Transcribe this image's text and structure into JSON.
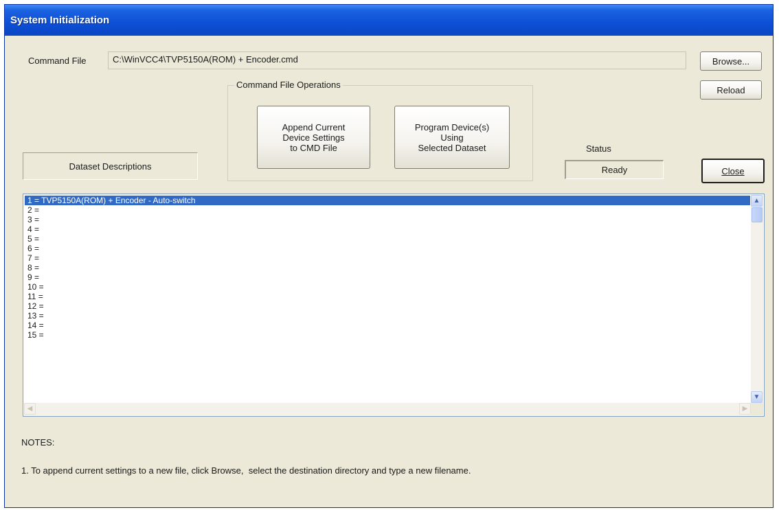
{
  "window": {
    "title": "System Initialization"
  },
  "command_file": {
    "label": "Command File",
    "value": "C:\\WinVCC4\\TVP5150A(ROM) + Encoder.cmd"
  },
  "buttons": {
    "browse": "Browse...",
    "reload": "Reload",
    "close": "Close",
    "append": "Append Current\nDevice Settings\nto CMD File",
    "program": "Program Device(s)\nUsing\nSelected Dataset"
  },
  "operations_group": {
    "title": "Command File Operations"
  },
  "dataset_descriptions": {
    "label": "Dataset Descriptions"
  },
  "status": {
    "label": "Status",
    "value": "Ready"
  },
  "dataset_list": {
    "items": [
      "1 = TVP5150A(ROM) + Encoder - Auto-switch",
      "2 =",
      "3 =",
      "4 =",
      "5 =",
      "6 =",
      "7 =",
      "8 =",
      "9 =",
      "10 =",
      "11 =",
      "12 =",
      "13 =",
      "14 =",
      "15 ="
    ],
    "selected_index": 0
  },
  "notes": {
    "heading": "NOTES:",
    "line1": "1. To append current settings to a new file, click Browse,  select the destination directory and type a new filename."
  },
  "icons": {
    "scroll_up": "chevron-up-icon",
    "scroll_down": "chevron-down-icon",
    "scroll_left": "chevron-left-icon",
    "scroll_right": "chevron-right-icon"
  },
  "colors": {
    "titlebar": "#0d4fd6",
    "selection": "#316ac5",
    "window_bg": "#ece9d8"
  }
}
